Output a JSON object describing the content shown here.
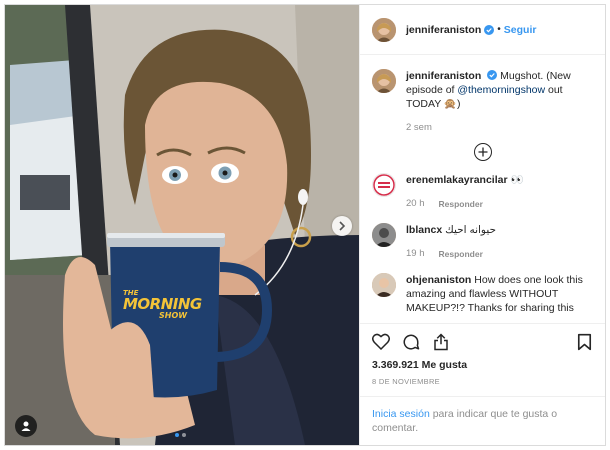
{
  "header": {
    "username": "jenniferaniston",
    "separator": "•",
    "follow_label": "Seguir"
  },
  "caption": {
    "username": "jenniferaniston",
    "text_before": "Mugshot. (New episode of ",
    "mention": "@themorningshow",
    "text_after": " out TODAY 🙊)",
    "time": "2 sem"
  },
  "comments": [
    {
      "username": "erenemlakayrancilar",
      "text": " 👀",
      "time": "20 h",
      "reply_label": "Responder"
    },
    {
      "username": "lblancx",
      "text": "حيوانه احيك",
      "time": "19 h",
      "reply_label": "Responder"
    },
    {
      "username": "ohjenaniston",
      "text": "How does one look this amazing and flawless WITHOUT MAKEUP?!? Thanks for sharing this",
      "time": "",
      "reply_label": ""
    }
  ],
  "likes": "3.369.921 Me gusta",
  "date": "8 de noviembre",
  "login": {
    "link": "Inicia sesión",
    "text": " para indicar que te gusta o comentar."
  },
  "carousel": {
    "current": 1,
    "total": 2
  },
  "mug_text": {
    "line1": "THE",
    "line2": "MORNING",
    "line3": "SHOW"
  },
  "colors": {
    "link": "#3897f0",
    "verified": "#3897f0",
    "mug": "#1f3f6e",
    "mug_text": "#f3c338"
  },
  "icons": [
    "verified-icon",
    "plus-circle-icon",
    "heart-icon",
    "comment-icon",
    "share-icon",
    "bookmark-icon",
    "chevron-right-icon",
    "user-tag-icon"
  ]
}
